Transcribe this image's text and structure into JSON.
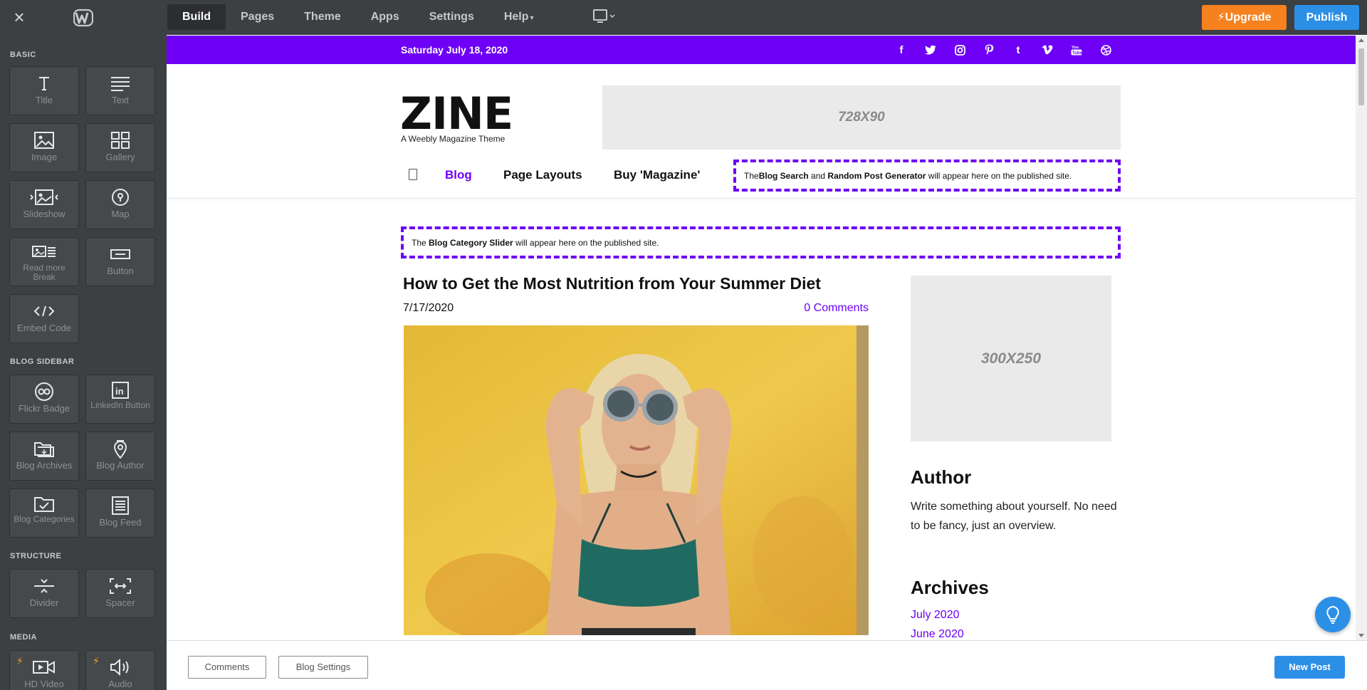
{
  "topbar": {
    "close_icon": "×",
    "tabs": [
      {
        "label": "Build",
        "active": true
      },
      {
        "label": "Pages",
        "active": false
      },
      {
        "label": "Theme",
        "active": false
      },
      {
        "label": "Apps",
        "active": false
      },
      {
        "label": "Settings",
        "active": false
      },
      {
        "label": "Help",
        "active": false
      }
    ],
    "help_caret": "▾",
    "upgrade_label": "Upgrade",
    "publish_label": "Publish",
    "upgrade_color": "#f5821f",
    "publish_color": "#2c8fe6"
  },
  "sidebar": {
    "sections": {
      "basic": "BASIC",
      "blog_sidebar": "BLOG SIDEBAR",
      "structure": "STRUCTURE",
      "media": "MEDIA"
    },
    "basic": [
      {
        "label": "Title",
        "icon": "title-icon"
      },
      {
        "label": "Text",
        "icon": "text-icon"
      },
      {
        "label": "Image",
        "icon": "image-icon"
      },
      {
        "label": "Gallery",
        "icon": "gallery-icon"
      },
      {
        "label": "Slideshow",
        "icon": "slideshow-icon"
      },
      {
        "label": "Map",
        "icon": "map-icon"
      },
      {
        "label": "Read more Break",
        "icon": "read-more-icon"
      },
      {
        "label": "Button",
        "icon": "button-icon"
      },
      {
        "label": "Embed Code",
        "icon": "embed-code-icon"
      }
    ],
    "blog_sidebar": [
      {
        "label": "Flickr Badge",
        "icon": "flickr-icon"
      },
      {
        "label": "LinkedIn Button",
        "icon": "linkedin-icon"
      },
      {
        "label": "Blog Archives",
        "icon": "archives-icon"
      },
      {
        "label": "Blog Author",
        "icon": "author-icon"
      },
      {
        "label": "Blog Categories",
        "icon": "categories-icon"
      },
      {
        "label": "Blog Feed",
        "icon": "feed-icon"
      }
    ],
    "structure": [
      {
        "label": "Divider",
        "icon": "divider-icon"
      },
      {
        "label": "Spacer",
        "icon": "spacer-icon"
      }
    ],
    "media": [
      {
        "label": "HD Video",
        "icon": "video-icon"
      },
      {
        "label": "Audio",
        "icon": "audio-icon"
      }
    ]
  },
  "site": {
    "accent_color": "#6d00f5",
    "date": "Saturday July 18, 2020",
    "social": [
      "facebook-icon",
      "twitter-icon",
      "instagram-icon",
      "pinterest-icon",
      "tumblr-icon",
      "vimeo-icon",
      "youtube-icon",
      "dribbble-icon"
    ],
    "logo": "ZINE",
    "tagline": "A Weebly Magazine Theme",
    "banner_ad": "728X90",
    "nav": [
      "Blog",
      "Page Layouts",
      "Buy 'Magazine'"
    ],
    "search_notice": {
      "pre": "The ",
      "b1": "Blog Search",
      "mid": " and ",
      "b2": "Random Post Generator",
      "post": " will appear here on the published site."
    },
    "slider_notice": {
      "pre": "The ",
      "b1": "Blog Category Slider",
      "post": " will appear here on the published site."
    }
  },
  "post": {
    "title": "How to Get the Most Nutrition from Your Summer Diet",
    "date": "7/17/2020",
    "comments": "0 Comments"
  },
  "aside": {
    "ad": "300X250",
    "author_heading": "Author",
    "author_text": "Write something about yourself. No need to be fancy, just an overview.",
    "archives_heading": "Archives",
    "archives": [
      "July 2020",
      "June 2020"
    ]
  },
  "bottombar": {
    "comments_label": "Comments",
    "blog_settings_label": "Blog Settings",
    "new_post_label": "New Post"
  }
}
